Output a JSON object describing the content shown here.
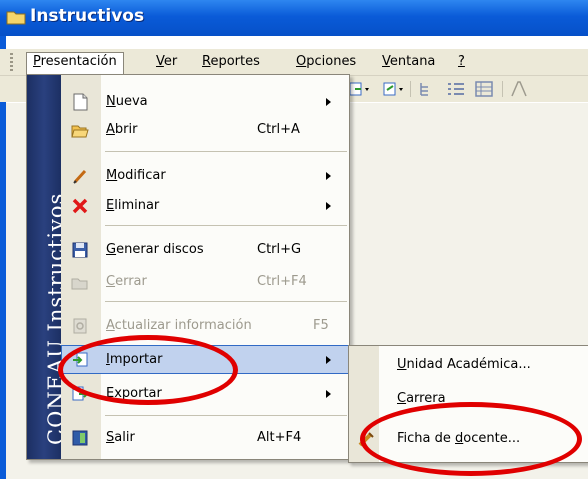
{
  "window": {
    "title": "Instructivos"
  },
  "menubar": [
    {
      "pre": "",
      "u": "P",
      "post": "resentación"
    },
    {
      "pre": "",
      "u": "V",
      "post": "er"
    },
    {
      "pre": "",
      "u": "R",
      "post": "eportes"
    },
    {
      "pre": "",
      "u": "O",
      "post": "pciones"
    },
    {
      "pre": "",
      "u": "V",
      "post": "entana"
    },
    {
      "pre": "",
      "u": "?",
      "post": ""
    }
  ],
  "banner": "CONEAU  Instructivos",
  "menu": {
    "nueva": {
      "u": "N",
      "rest": "ueva"
    },
    "abrir": {
      "u": "A",
      "rest": "brir",
      "shortcut": "Ctrl+A"
    },
    "modificar": {
      "u": "M",
      "rest": "odificar"
    },
    "eliminar": {
      "u": "E",
      "rest": "liminar"
    },
    "generar": {
      "u": "G",
      "rest": "enerar discos",
      "shortcut": "Ctrl+G"
    },
    "cerrar": {
      "u": "C",
      "rest": "errar",
      "shortcut": "Ctrl+F4"
    },
    "actualizar": {
      "u": "A",
      "rest": "ctualizar información",
      "shortcut": "F5"
    },
    "importar": {
      "u": "I",
      "rest": "mportar"
    },
    "exportar": {
      "u": "E",
      "rest": "xportar"
    },
    "salir": {
      "u": "S",
      "rest": "alir",
      "shortcut": "Alt+F4"
    }
  },
  "submenu": {
    "unidad": {
      "pre": "",
      "u": "U",
      "post": "nidad Académica..."
    },
    "carrera": {
      "pre": "",
      "u": "C",
      "post": "arrera"
    },
    "ficha": {
      "pre": "Ficha de ",
      "u": "d",
      "post": "ocente..."
    }
  },
  "colors": {
    "highlight": "#c1d2ee",
    "annotation": "#e00000",
    "titlebar": "#0a5bd8",
    "banner": "#1c2f63"
  }
}
